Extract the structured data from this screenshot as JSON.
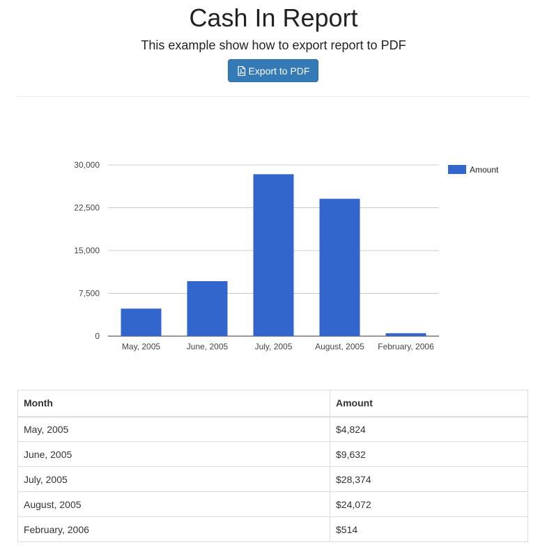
{
  "header": {
    "title": "Cash In Report",
    "subtitle": "This example show how to export report to PDF",
    "export_label": "Export to PDF"
  },
  "chart_data": {
    "type": "bar",
    "categories": [
      "May, 2005",
      "June, 2005",
      "July, 2005",
      "August, 2005",
      "February, 2006"
    ],
    "series": [
      {
        "name": "Amount",
        "values": [
          4824,
          9632,
          28374,
          24072,
          514
        ],
        "color": "#3366cc"
      }
    ],
    "yticks": [
      "0",
      "7,500",
      "15,000",
      "22,500",
      "30,000"
    ],
    "ylim": [
      0,
      30000
    ],
    "grid": true,
    "legend": "right"
  },
  "table": {
    "columns": [
      "Month",
      "Amount"
    ],
    "rows": [
      [
        "May, 2005",
        "$4,824"
      ],
      [
        "June, 2005",
        "$9,632"
      ],
      [
        "July, 2005",
        "$28,374"
      ],
      [
        "August, 2005",
        "$24,072"
      ],
      [
        "February, 2006",
        "$514"
      ]
    ]
  }
}
